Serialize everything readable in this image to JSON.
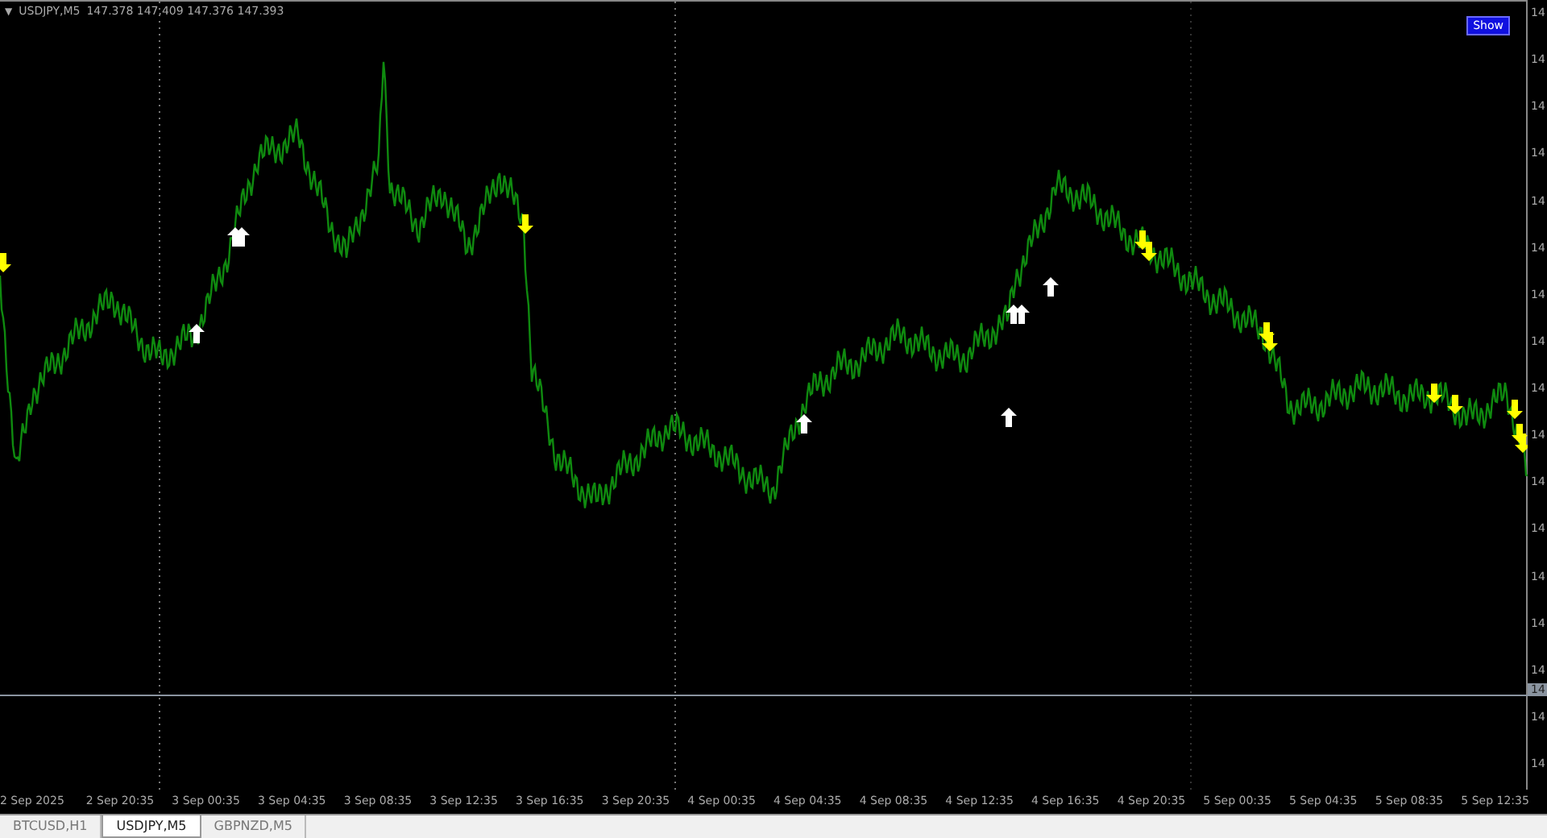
{
  "chart_header": {
    "menu_icon": "▼",
    "symbol": "USDJPY,M5",
    "prices": "147.378 147.409 147.376 147.393"
  },
  "show_button": {
    "label": "Show"
  },
  "price_axis": {
    "labels": [
      "14",
      "14",
      "14",
      "14",
      "14",
      "14",
      "14",
      "14",
      "14",
      "14",
      "14",
      "14",
      "14",
      "14",
      "14",
      "14",
      "14"
    ],
    "current_price": "14"
  },
  "time_axis": {
    "labels": [
      "2 Sep 2025",
      "2 Sep 20:35",
      "3 Sep 00:35",
      "3 Sep 04:35",
      "3 Sep 08:35",
      "3 Sep 12:35",
      "3 Sep 16:35",
      "3 Sep 20:35",
      "4 Sep 00:35",
      "4 Sep 04:35",
      "4 Sep 08:35",
      "4 Sep 12:35",
      "4 Sep 16:35",
      "4 Sep 20:35",
      "5 Sep 00:35",
      "5 Sep 04:35",
      "5 Sep 08:35",
      "5 Sep 12:35"
    ]
  },
  "tabs": [
    {
      "label": "BTCUSD,H1",
      "selected": false
    },
    {
      "label": "USDJPY,M5",
      "selected": true
    },
    {
      "label": "GBPNZD,M5",
      "selected": false
    }
  ]
}
